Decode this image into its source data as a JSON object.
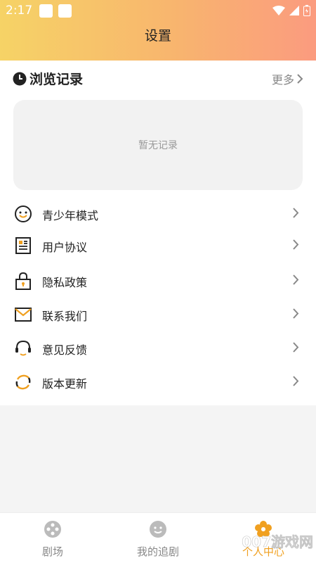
{
  "status_bar": {
    "time": "2:17"
  },
  "header": {
    "title": "设置"
  },
  "history": {
    "title": "浏览记录",
    "more_label": "更多",
    "empty_text": "暂无记录"
  },
  "menu": [
    {
      "label": "青少年模式",
      "icon": "smiley-icon"
    },
    {
      "label": "用户协议",
      "icon": "document-icon"
    },
    {
      "label": "隐私政策",
      "icon": "lock-icon"
    },
    {
      "label": "联系我们",
      "icon": "mail-icon"
    },
    {
      "label": "意见反馈",
      "icon": "headset-icon"
    },
    {
      "label": "版本更新",
      "icon": "refresh-icon"
    }
  ],
  "tabbar": {
    "tabs": [
      {
        "label": "剧场",
        "icon": "film-reel-icon"
      },
      {
        "label": "我的追剧",
        "icon": "smiley-icon"
      },
      {
        "label": "个人中心",
        "icon": "flower-icon"
      }
    ],
    "active_index": 2
  },
  "watermark": "007游戏网",
  "colors": {
    "header_gradient_start": "#f6d366",
    "header_gradient_end": "#fb9b7f",
    "accent_orange": "#f0a020",
    "text_primary": "#222222",
    "text_secondary": "#888888"
  }
}
